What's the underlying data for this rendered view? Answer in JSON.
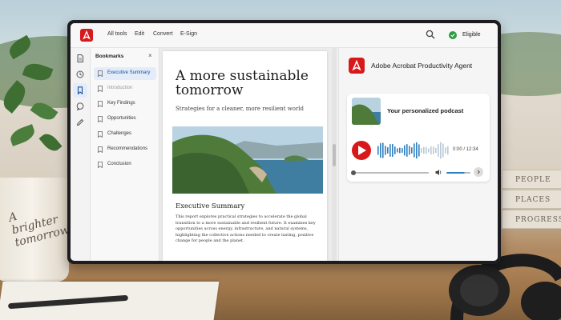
{
  "app": {
    "name": "Adobe Acrobat",
    "brand_color": "#d7191c"
  },
  "toolbar": {
    "menu": [
      "All tools",
      "Edit",
      "Convert",
      "E-Sign"
    ],
    "search_icon": "search-icon",
    "eligible_label": "Eligible",
    "eligible_color": "#2e9c45"
  },
  "rail": {
    "icons": [
      "document-icon",
      "clock-icon",
      "bookmark-icon",
      "comment-icon",
      "pen-icon"
    ]
  },
  "bookmarks": {
    "title": "Bookmarks",
    "close": "×",
    "items": [
      {
        "label": "Executive Summary",
        "state": "active"
      },
      {
        "label": "Introduction",
        "state": "dim"
      },
      {
        "label": "Key Findings",
        "state": "normal"
      },
      {
        "label": "Opportunities",
        "state": "normal"
      },
      {
        "label": "Challenges",
        "state": "normal"
      },
      {
        "label": "Recommendations",
        "state": "normal"
      },
      {
        "label": "Conclusion",
        "state": "normal"
      }
    ]
  },
  "document": {
    "title": "A more sustainable tomorrow",
    "subtitle": "Strategies for a cleaner, more resilient world",
    "section_heading": "Executive Summary",
    "body": "This report explores practical strategies to accelerate the global transition to a more sustainable and resilient future. It examines key opportunities across energy, infrastructure, and natural systems, highlighting the collective actions needed to create lasting, positive change for people and the planet."
  },
  "agent": {
    "title": "Adobe Acrobat Productivity Agent",
    "podcast": {
      "title": "Your personalized podcast",
      "time": "0:00 / 12:34",
      "progress": 0,
      "volume": 0.75,
      "accent": "#2f7fbf"
    }
  },
  "scene": {
    "mug_text": "A brighter tomorrow",
    "books": [
      "PEOPLE",
      "PLACES",
      "PROGRESS"
    ]
  }
}
